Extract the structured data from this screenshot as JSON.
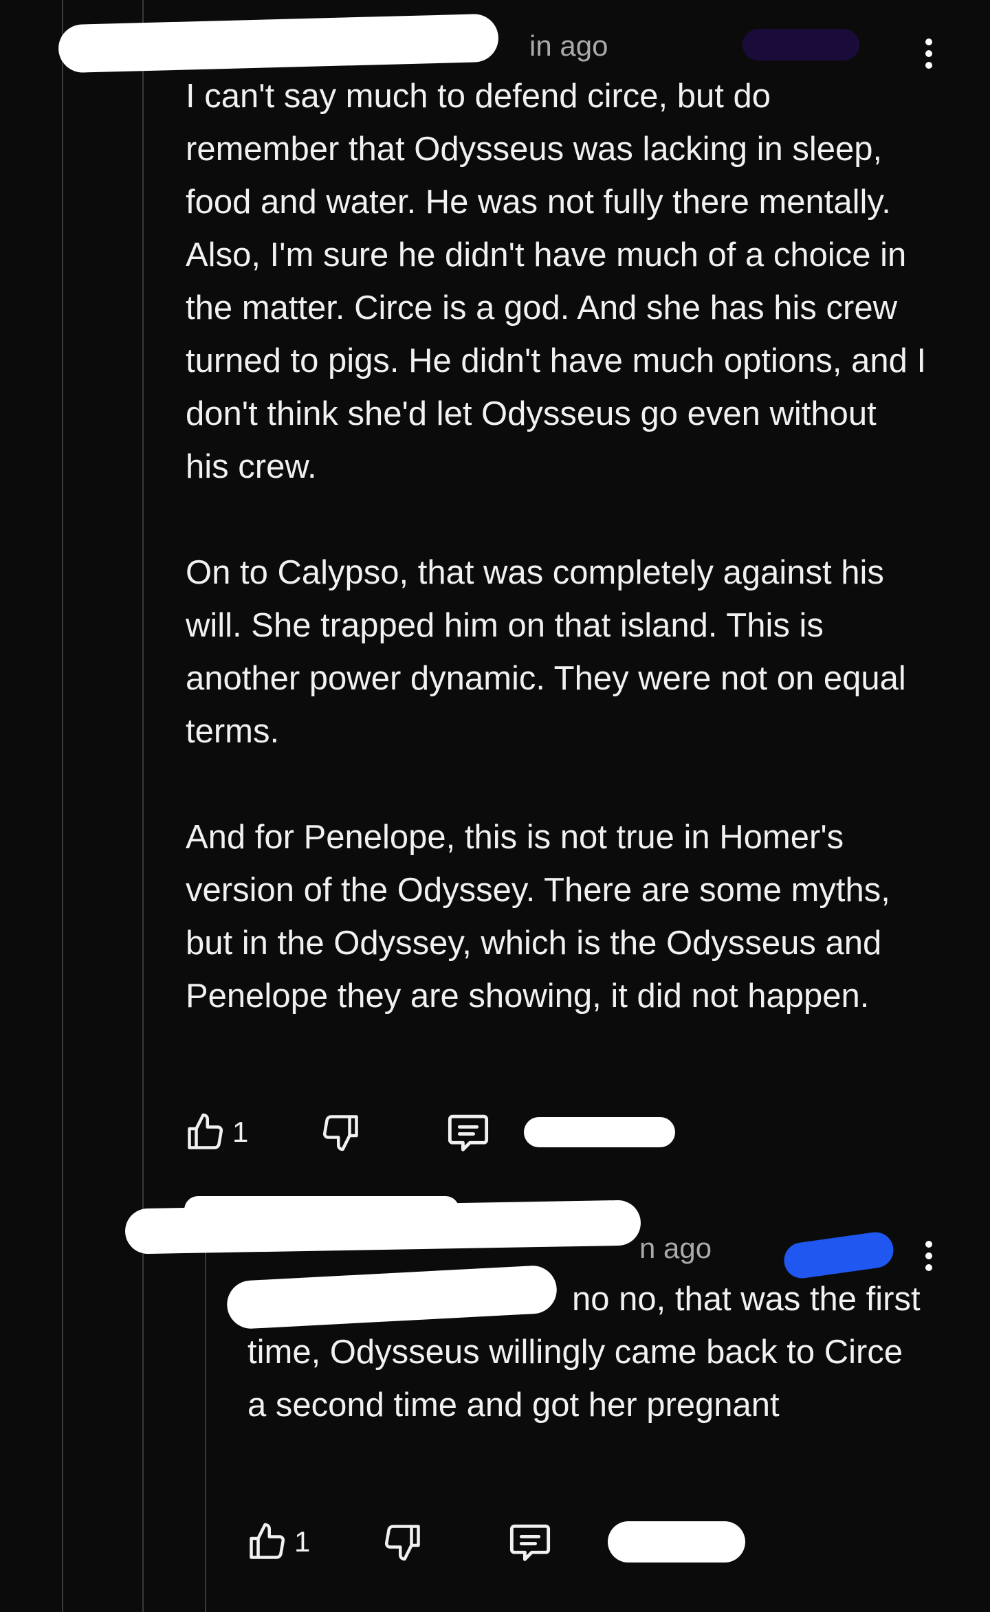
{
  "comments": [
    {
      "author_redacted": true,
      "time_suffix": "in ago",
      "paragraphs": [
        "I can't say much to defend circe, but do remember that Odysseus was lacking in sleep, food and water. He was not fully there mentally. Also, I'm sure he didn't have much of a choice in the matter. Circe is a god. And she has his crew turned to pigs. He didn't have much options, and I don't think she'd let Odysseus go even without his crew.",
        "On to Calypso, that was completely against his will. She trapped him on that island. This is another power dynamic. They were not on equal terms.",
        "And for Penelope, this is not true in Homer's version of the Odyssey. There are some myths, but in the Odyssey, which is the Odysseus and Penelope they are showing, it did not happen."
      ],
      "like_count": "1",
      "icons": {
        "like": "thumbs-up-icon",
        "dislike": "thumbs-down-icon",
        "reply": "reply-comment-icon",
        "more": "more-vertical-icon"
      }
    },
    {
      "author_redacted": true,
      "time_suffix": "n ago",
      "text_visible": "no no, that was the first time, Odysseus willingly came back to Circe a second time and got her pregnant",
      "like_count": "1",
      "icons": {
        "like": "thumbs-up-icon",
        "dislike": "thumbs-down-icon",
        "reply": "reply-comment-icon",
        "more": "more-vertical-icon"
      }
    }
  ],
  "colors": {
    "background": "#0b0b0b",
    "text": "#f1f1f1",
    "meta_text": "#aaaaaa",
    "thread_line": "#3a3a3a",
    "redaction_white": "#ffffff",
    "redaction_blue": "#1f57f0"
  }
}
